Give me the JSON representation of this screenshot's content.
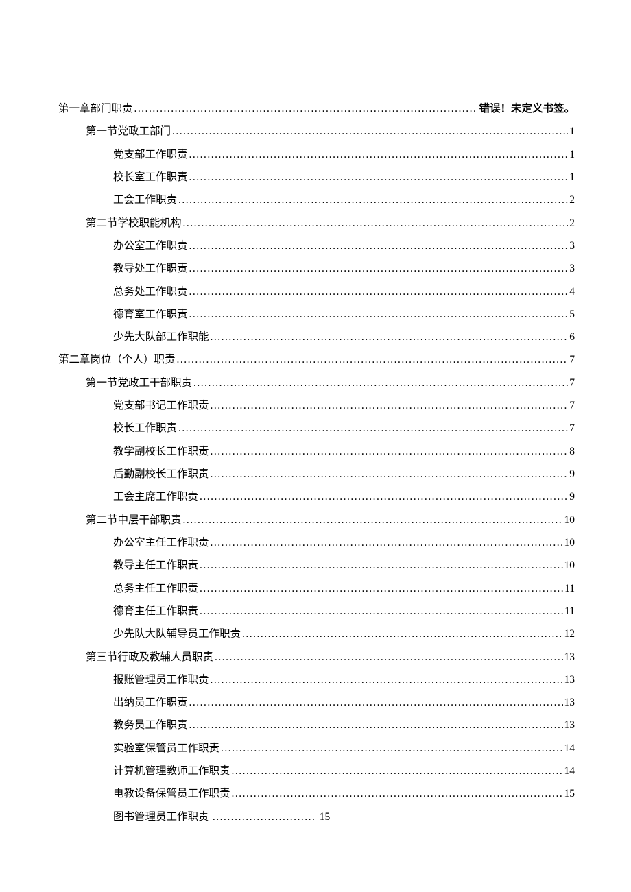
{
  "leader": "............................................................................................................................................",
  "error_page": "错误！未定义书签。",
  "toc": [
    {
      "level": 0,
      "label": "第一章部门职责",
      "page": "__ERR__"
    },
    {
      "level": 1,
      "label": "第一节党政工部门",
      "page": "1"
    },
    {
      "level": 2,
      "label": "党支部工作职责",
      "page": "1"
    },
    {
      "level": 2,
      "label": "校长室工作职责",
      "page": "1"
    },
    {
      "level": 2,
      "label": "工会工作职责",
      "page": "2"
    },
    {
      "level": 1,
      "label": "第二节学校职能机构",
      "page": "2"
    },
    {
      "level": 2,
      "label": "办公室工作职责",
      "page": "3"
    },
    {
      "level": 2,
      "label": "教导处工作职责",
      "page": "3"
    },
    {
      "level": 2,
      "label": "总务处工作职责",
      "page": "4"
    },
    {
      "level": 2,
      "label": "德育室工作职责",
      "page": "5"
    },
    {
      "level": 2,
      "label": "少先大队部工作职能",
      "page": "6"
    },
    {
      "level": 0,
      "label": "第二章岗位（个人）职责",
      "page": "7"
    },
    {
      "level": 1,
      "label": "第一节党政工干部职责",
      "page": "7"
    },
    {
      "level": 2,
      "label": "党支部书记工作职责",
      "page": "7"
    },
    {
      "level": 2,
      "label": "校长工作职责",
      "page": "7"
    },
    {
      "level": 2,
      "label": "教学副校长工作职责",
      "page": "8"
    },
    {
      "level": 2,
      "label": "后勤副校长工作职责",
      "page": "9"
    },
    {
      "level": 2,
      "label": "工会主席工作职责",
      "page": "9"
    },
    {
      "level": 1,
      "label": "第二节中层干部职责",
      "page": "10"
    },
    {
      "level": 2,
      "label": "办公室主任工作职责",
      "page": "10"
    },
    {
      "level": 2,
      "label": "教导主任工作职责",
      "page": "10"
    },
    {
      "level": 2,
      "label": "总务主任工作职责",
      "page": "11"
    },
    {
      "level": 2,
      "label": "德育主任工作职责",
      "page": "11"
    },
    {
      "level": 2,
      "label": "少先队大队辅导员工作职责",
      "page": "12"
    },
    {
      "level": 1,
      "label": "第三节行政及教辅人员职责",
      "page": "13"
    },
    {
      "level": 2,
      "label": "报账管理员工作职责",
      "page": "13"
    },
    {
      "level": 2,
      "label": "出纳员工作职责",
      "page": "13"
    },
    {
      "level": 2,
      "label": "教务员工作职责",
      "page": "13"
    },
    {
      "level": 2,
      "label": "实验室保管员工作职责",
      "page": "14"
    },
    {
      "level": 2,
      "label": "计算机管理教师工作职责",
      "page": "14"
    },
    {
      "level": 2,
      "label": "电教设备保管员工作职责",
      "page": "15"
    },
    {
      "level": 2,
      "label": "图书管理员工作职责",
      "page": "15",
      "short_leader": true
    }
  ]
}
